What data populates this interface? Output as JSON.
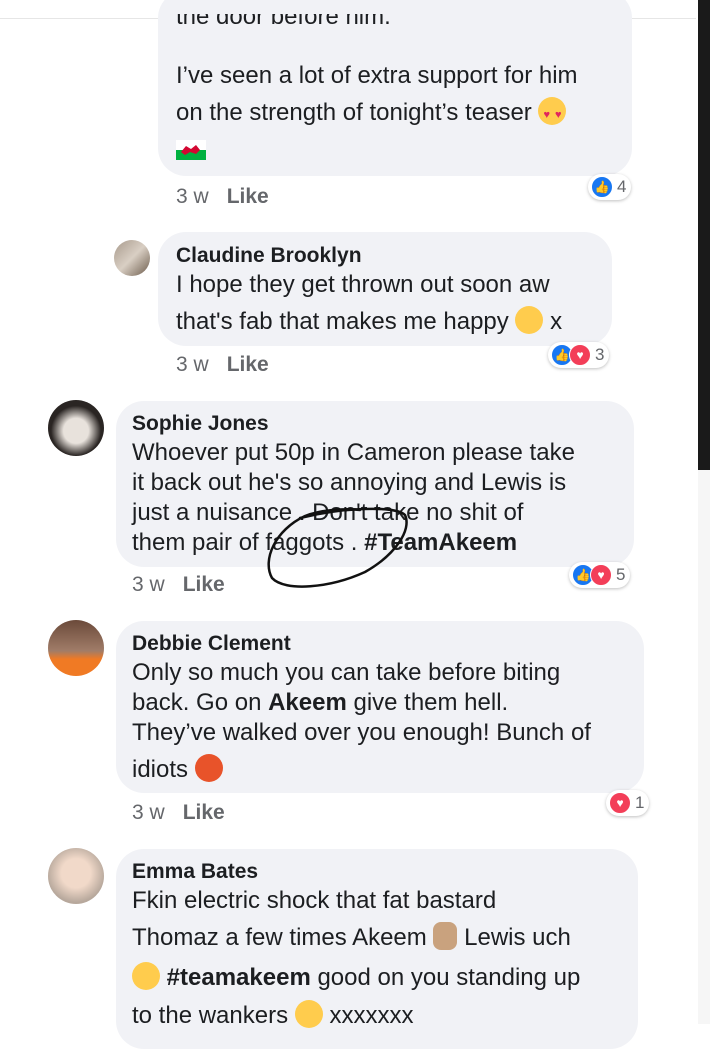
{
  "comments": [
    {
      "partial_top": "the door before him.",
      "lines": [
        "I’ve seen a lot of extra support for him",
        "on the strength of tonight’s teaser"
      ],
      "emoji_after_line2": "heart-eyes-emoji",
      "flag": "wales-flag-emoji",
      "time": "3 w",
      "like": "Like",
      "reactions": [
        "like"
      ],
      "reaction_count": "4"
    },
    {
      "name": "Claudine Brooklyn",
      "lines": [
        "I hope they get thrown out soon aw",
        "that's fab that makes me happy"
      ],
      "line2_suffix": "x",
      "emoji": "smiling-face-emoji",
      "time": "3 w",
      "like": "Like",
      "reactions": [
        "like",
        "love"
      ],
      "reaction_count": "3"
    },
    {
      "name": "Sophie Jones",
      "lines": [
        "Whoever put 50p in Cameron  please take",
        "it back out he's so annoying and Lewis is",
        "just a nuisance . Don't take no shit of",
        "them pair of faggots . "
      ],
      "hashtag": "#TeamAkeem",
      "time": "3 w",
      "like": "Like",
      "reactions": [
        "like",
        "love"
      ],
      "reaction_count": "5"
    },
    {
      "name": "Debbie Clement",
      "lines": [
        "Only so much you can take before biting",
        "back. Go on ",
        "Akeem",
        " give them hell.",
        "They’ve walked over you enough! Bunch of",
        "idiots"
      ],
      "emoji": "angry-face-emoji",
      "time": "3 w",
      "like": "Like",
      "reactions": [
        "love"
      ],
      "reaction_count": "1"
    },
    {
      "name": "Emma Bates",
      "lines": [
        "Fkin electric shock that fat bastard",
        "Thomaz a few times Akeem",
        "Lewis uch",
        "#teamakeem",
        " good on you standing up",
        "to the wankers",
        "xxxxxxx"
      ],
      "emoji1": "victory-hand-emoji",
      "emoji2": "smirking-face-emoji",
      "emoji3": "sunglasses-face-emoji"
    }
  ],
  "colors": {
    "bubble": "#f1f2f6",
    "like_blue": "#1877f2",
    "love_red": "#f33e58",
    "meta_gray": "#65676b"
  }
}
